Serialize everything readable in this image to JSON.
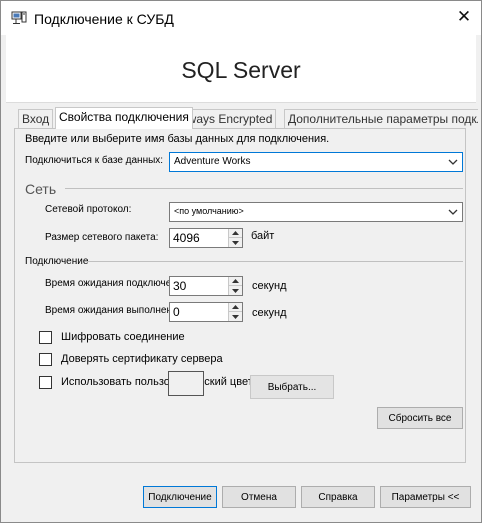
{
  "window": {
    "title": "Подключение к СУБД",
    "close_glyph": "✕"
  },
  "banner": {
    "title": "SQL Server"
  },
  "tabs": [
    {
      "label": "Вход"
    },
    {
      "label": "Свойства подключения"
    },
    {
      "label": "Always Encrypted"
    },
    {
      "label": "Дополнительные параметры подключения"
    }
  ],
  "form": {
    "prompt": "Введите или выберите имя базы данных для подключения.",
    "database": {
      "label": "Подключиться к базе данных:",
      "value": "Adventure Works"
    },
    "network_group": "Сеть",
    "protocol": {
      "label": "Сетевой протокол:",
      "value": "<по умолчанию>"
    },
    "packet_size": {
      "label": "Размер сетевого пакета:",
      "value": "4096",
      "unit": "байт"
    },
    "connection_group": "Подключение",
    "connect_timeout": {
      "label": "Время ожидания подключения:",
      "value": "30",
      "unit": "секунд"
    },
    "execution_timeout": {
      "label": "Время ожидания выполнения:",
      "value": "0",
      "unit": "секунд"
    },
    "checkboxes": {
      "encrypt": "Шифровать соединение",
      "trust_cert": "Доверять сертификату сервера",
      "custom_color": "Использовать пользовательский цвет:"
    },
    "choose_button": "Выбрать...",
    "reset_button": "Сбросить все"
  },
  "footer": {
    "connect": "Подключение",
    "cancel": "Отмена",
    "help": "Справка",
    "options": "Параметры <<"
  },
  "colors": {
    "focus_accent": "#0078d7",
    "dialog_background": "#f0f0f0"
  },
  "icons": {
    "title": "server-connection-icon",
    "dropdown": "chevron-down-icon",
    "spin_up": "caret-up-icon",
    "spin_down": "caret-down-icon"
  }
}
